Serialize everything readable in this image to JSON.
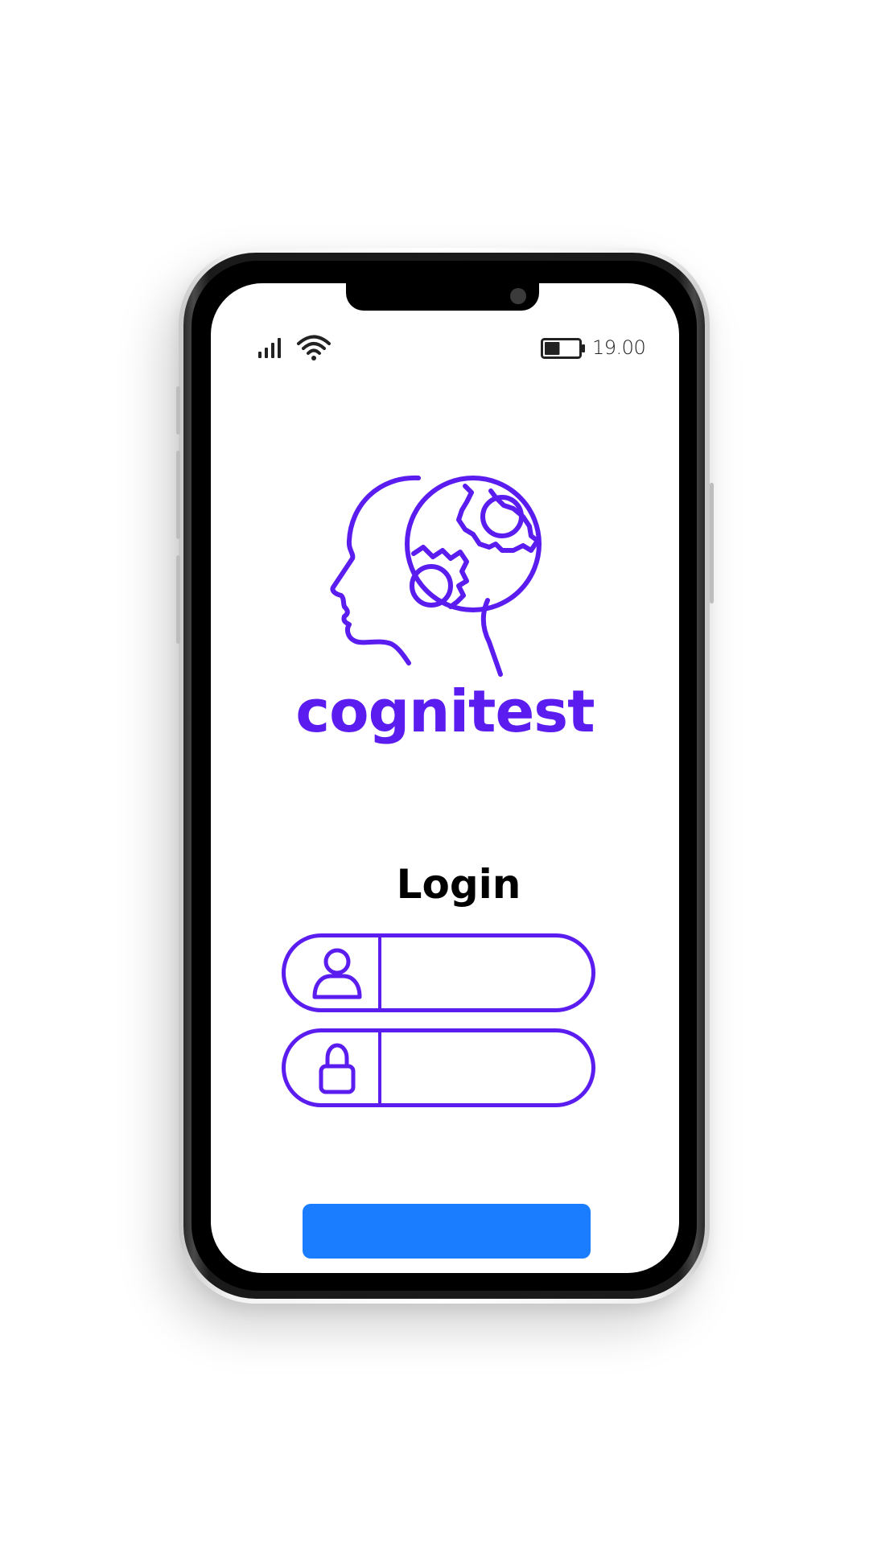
{
  "status_bar": {
    "time": "19.00",
    "signal_icon": "signal-bars-icon",
    "wifi_icon": "wifi-icon",
    "battery_icon": "battery-icon",
    "battery_level": 0.45
  },
  "brand": {
    "logo_icon": "head-gears-icon",
    "name": "cognitest",
    "color": "#5b1cf0"
  },
  "login": {
    "title": "Login",
    "username_field": {
      "icon": "user-icon",
      "value": "",
      "placeholder": ""
    },
    "password_field": {
      "icon": "lock-icon",
      "value": "",
      "placeholder": ""
    },
    "submit_button": {
      "label": "",
      "color": "#1a7dff"
    }
  }
}
